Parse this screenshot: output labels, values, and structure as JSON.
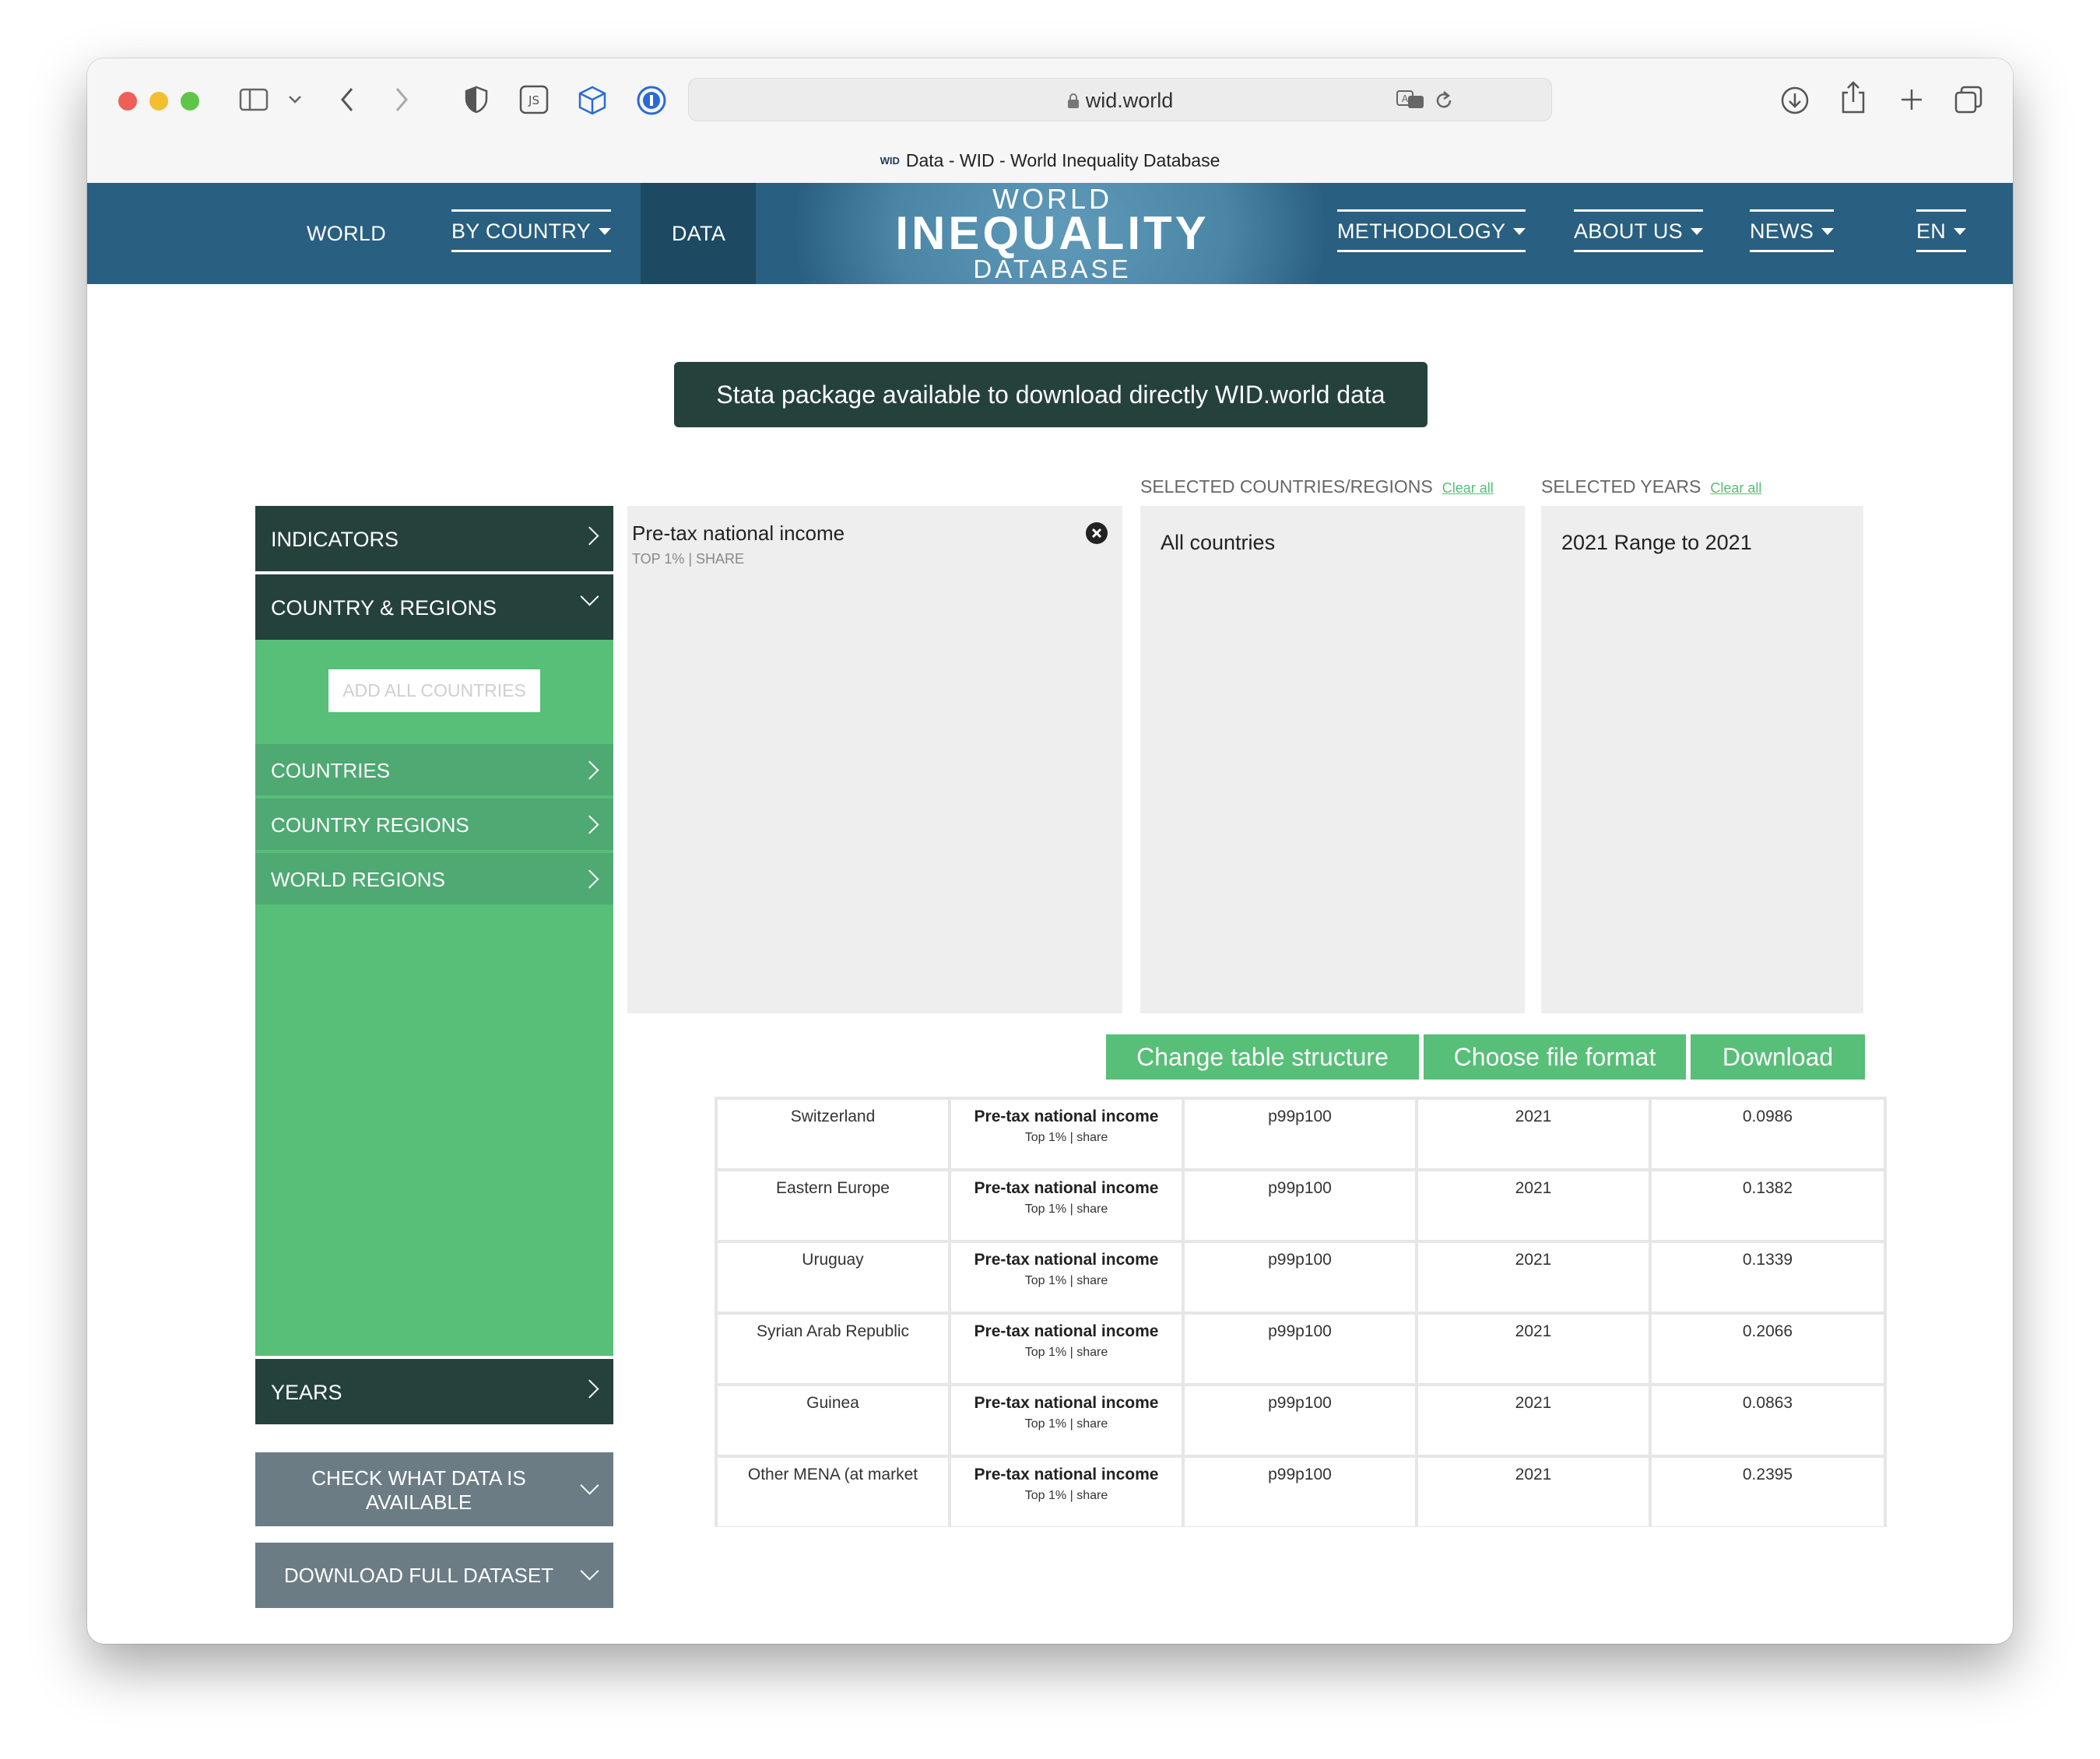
{
  "browser": {
    "url": "wid.world",
    "tab_title": "Data - WID - World Inequality Database",
    "tab_favicon": "WID",
    "toolbar_icons": [
      "sidebar-icon",
      "chevron-down-icon",
      "back-icon",
      "forward-icon",
      "shield-icon",
      "js-icon",
      "cube-icon",
      "password-icon",
      "translate-icon",
      "reload-icon",
      "download-icon",
      "share-icon",
      "plus-icon",
      "tabs-icon"
    ]
  },
  "nav": {
    "world": "WORLD",
    "by_country": "BY COUNTRY",
    "data": "DATA",
    "logo_line1": "WORLD",
    "logo_line2": "INEQUALITY",
    "logo_line3": "DATABASE",
    "methodology": "METHODOLOGY",
    "about_us": "ABOUT US",
    "news": "NEWS",
    "language": "EN"
  },
  "banner": "Stata package available to download directly WID.world data",
  "sidebar": {
    "indicators": "INDICATORS",
    "country_regions": "COUNTRY & REGIONS",
    "add_all": "ADD ALL COUNTRIES",
    "countries": "COUNTRIES",
    "country_regions_sub": "COUNTRY REGIONS",
    "world_regions": "WORLD REGIONS",
    "years": "YEARS",
    "check_data": "CHECK WHAT DATA IS AVAILABLE",
    "download_full": "DOWNLOAD FULL DATASET"
  },
  "selection": {
    "indicator_title": "Pre-tax national income",
    "indicator_sub": "TOP 1% | SHARE",
    "countries_header": "SELECTED COUNTRIES/REGIONS",
    "years_header": "SELECTED YEARS",
    "clear_all": "Clear all",
    "countries_value": "All countries",
    "years_value": "2021 Range to 2021"
  },
  "actions": {
    "change_structure": "Change table structure",
    "file_format": "Choose file format",
    "download": "Download"
  },
  "table": {
    "rows": [
      {
        "country": "Switzerland",
        "indicator": "Pre-tax national income",
        "sub": "Top 1% | share",
        "percentile": "p99p100",
        "year": "2021",
        "value": "0.0986"
      },
      {
        "country": "Eastern Europe",
        "indicator": "Pre-tax national income",
        "sub": "Top 1% | share",
        "percentile": "p99p100",
        "year": "2021",
        "value": "0.1382"
      },
      {
        "country": "Uruguay",
        "indicator": "Pre-tax national income",
        "sub": "Top 1% | share",
        "percentile": "p99p100",
        "year": "2021",
        "value": "0.1339"
      },
      {
        "country": "Syrian Arab Republic",
        "indicator": "Pre-tax national income",
        "sub": "Top 1% | share",
        "percentile": "p99p100",
        "year": "2021",
        "value": "0.2066"
      },
      {
        "country": "Guinea",
        "indicator": "Pre-tax national income",
        "sub": "Top 1% | share",
        "percentile": "p99p100",
        "year": "2021",
        "value": "0.0863"
      },
      {
        "country": "Other MENA (at market",
        "indicator": "Pre-tax national income",
        "sub": "Top 1% | share",
        "percentile": "p99p100",
        "year": "2021",
        "value": "0.2395"
      }
    ]
  },
  "colors": {
    "nav_bg": "#295f80",
    "dark_green": "#25413c",
    "accent_green": "#57bf77",
    "slate": "#6b7c85"
  }
}
